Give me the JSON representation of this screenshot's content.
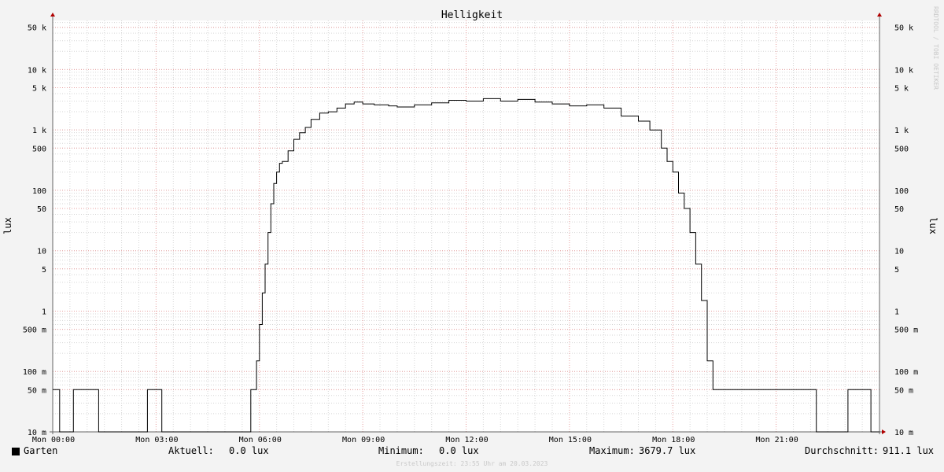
{
  "chart_data": {
    "type": "line",
    "title": "Helligkeit",
    "ylabel": "lux",
    "y_scale": "log",
    "ylim": [
      0.01,
      65000
    ],
    "xlim": [
      "Mon 00:00",
      "Mon 24:00"
    ],
    "x_tick_labels": [
      "Mon 00:00",
      "Mon 03:00",
      "Mon 06:00",
      "Mon 09:00",
      "Mon 12:00",
      "Mon 15:00",
      "Mon 18:00",
      "Mon 21:00"
    ],
    "y_tick_labels": [
      "50 k",
      "10 k",
      "5 k",
      "1 k",
      "500",
      "100",
      "50",
      "10",
      "5",
      "1",
      "500 m",
      "100 m",
      "50 m",
      "10 m"
    ],
    "y_tick_values": [
      50000,
      10000,
      5000,
      1000,
      500,
      100,
      50,
      10,
      5,
      1,
      0.5,
      0.1,
      0.05,
      0.01
    ],
    "grid": true,
    "series": [
      {
        "name": "Garten",
        "color": "#000000",
        "x": [
          "00:00",
          "00:12",
          "00:12",
          "00:36",
          "00:36",
          "01:20",
          "01:20",
          "02:45",
          "02:45",
          "03:10",
          "03:10",
          "05:45",
          "05:45",
          "05:55",
          "05:55",
          "06:00",
          "06:05",
          "06:10",
          "06:15",
          "06:20",
          "06:25",
          "06:30",
          "06:35",
          "06:40",
          "06:50",
          "07:00",
          "07:10",
          "07:20",
          "07:30",
          "07:45",
          "08:00",
          "08:15",
          "08:30",
          "08:45",
          "09:00",
          "09:20",
          "09:45",
          "10:00",
          "10:30",
          "11:00",
          "11:30",
          "12:00",
          "12:30",
          "13:00",
          "13:30",
          "14:00",
          "14:30",
          "15:00",
          "15:30",
          "16:00",
          "16:30",
          "17:00",
          "17:20",
          "17:40",
          "17:50",
          "18:00",
          "18:10",
          "18:20",
          "18:30",
          "18:40",
          "18:50",
          "19:00",
          "19:10",
          "19:20",
          "19:30",
          "19:40",
          "20:00",
          "21:00",
          "22:10",
          "22:10",
          "23:05",
          "23:05",
          "23:45",
          "23:45",
          "24:00"
        ],
        "y": [
          0.05,
          0.05,
          0.01,
          0.01,
          0.05,
          0.05,
          0.01,
          0.01,
          0.05,
          0.05,
          0.01,
          0.01,
          0.05,
          0.05,
          0.15,
          0.6,
          2,
          6,
          20,
          60,
          130,
          200,
          280,
          300,
          450,
          700,
          900,
          1100,
          1500,
          1900,
          2000,
          2300,
          2700,
          2900,
          2700,
          2600,
          2500,
          2400,
          2600,
          2800,
          3100,
          3000,
          3300,
          3000,
          3200,
          2900,
          2700,
          2500,
          2600,
          2300,
          1700,
          1400,
          1000,
          500,
          300,
          200,
          90,
          50,
          20,
          6,
          1.5,
          0.15,
          0.05,
          0.05,
          0.05,
          0.05,
          0.05,
          0.05,
          0.05,
          0.01,
          0.01,
          0.05,
          0.05,
          0.01,
          0.01
        ]
      }
    ],
    "legend": {
      "series_name": "Garten",
      "current_label": "Aktuell:",
      "current_value": "0.0 lux",
      "min_label": "Minimum:",
      "min_value": "0.0 lux",
      "max_label": "Maximum:",
      "max_value": "3679.7 lux",
      "avg_label": "Durchschnitt:",
      "avg_value": "911.1 lux"
    },
    "watermark": "RRDTOOL / TOBI OETIKER",
    "footer": "Erstellungszeit: 23:55 Uhr am 20.03.2023",
    "colors": {
      "background": "#f3f3f3",
      "plot_background": "#ffffff",
      "minor_grid": "#d6d6d6",
      "major_grid": "#e8a0a0",
      "axis": "#666666",
      "arrow": "#b00000",
      "line": "#000000"
    }
  }
}
